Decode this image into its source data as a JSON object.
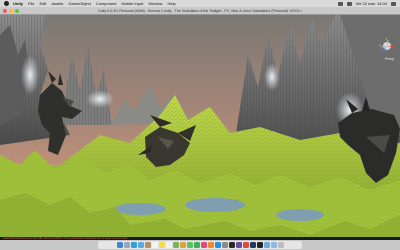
{
  "menubar": {
    "app_name": "Unity",
    "items": [
      "File",
      "Edit",
      "Assets",
      "GameObject",
      "Component",
      "Mobile Input",
      "Window",
      "Help"
    ],
    "clock": "Vie 22 mar. 14:04"
  },
  "window": {
    "title": "Unity 5.0.2f1 Personal (64bit) - Escena 2.unity - The Guardians of the Twilight - PC, Mac & Linux Standalone (Personal) <DX11>"
  },
  "scene": {
    "gizmo_label": "Persp",
    "colors": {
      "sky_top": "#7d7a74",
      "sky_horizon": "#d89c7c",
      "terrain_green": "#a9cc3a",
      "terrain_shadow": "#6f8c22",
      "rock": "#707070",
      "creature": "#3a3a36",
      "water": "#7f9fb0",
      "mist": "#dde6ee"
    }
  },
  "status": {
    "message": "Assets/Scripts/EnemyAI.cs(42,18): warning CS0414: The private field is assigned but its value is never used"
  },
  "dock": {
    "apps": [
      {
        "name": "finder-icon",
        "color": "#3f86d8"
      },
      {
        "name": "launchpad-icon",
        "color": "#9aa7b8"
      },
      {
        "name": "safari-icon",
        "color": "#2f9fe0"
      },
      {
        "name": "mail-icon",
        "color": "#5fa8e6"
      },
      {
        "name": "contacts-icon",
        "color": "#b68f62"
      },
      {
        "name": "calendar-icon",
        "color": "#f4f4f4"
      },
      {
        "name": "notes-icon",
        "color": "#f5d94e"
      },
      {
        "name": "reminders-icon",
        "color": "#f0f0f0"
      },
      {
        "name": "maps-icon",
        "color": "#73b75a"
      },
      {
        "name": "photos-icon",
        "color": "#e2a13e"
      },
      {
        "name": "messages-icon",
        "color": "#58c55d"
      },
      {
        "name": "facetime-icon",
        "color": "#3fb24f"
      },
      {
        "name": "itunes-icon",
        "color": "#e3467d"
      },
      {
        "name": "ibooks-icon",
        "color": "#f08b2d"
      },
      {
        "name": "appstore-icon",
        "color": "#2b8fe0"
      },
      {
        "name": "preferences-icon",
        "color": "#8b8b8b"
      },
      {
        "name": "unity-icon",
        "color": "#2a2a2a"
      },
      {
        "name": "monodevelop-icon",
        "color": "#6a4aa0"
      },
      {
        "name": "chrome-icon",
        "color": "#e04a3a"
      },
      {
        "name": "photoshop-icon",
        "color": "#1f3c60"
      },
      {
        "name": "terminal-icon",
        "color": "#222222"
      },
      {
        "name": "folder-icon",
        "color": "#6aa9e8"
      },
      {
        "name": "downloads-icon",
        "color": "#8fb8e6"
      },
      {
        "name": "trash-icon",
        "color": "#bdbdbd"
      }
    ]
  }
}
